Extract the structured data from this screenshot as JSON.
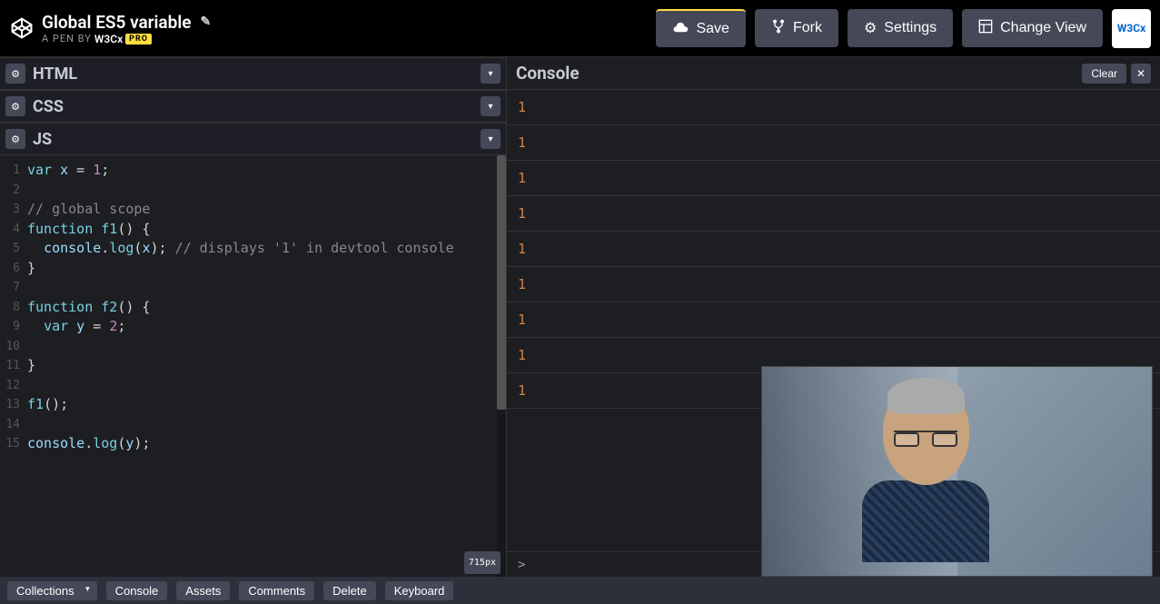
{
  "header": {
    "pen_title": "Global ES5 variable",
    "byline_prefix": "A PEN BY",
    "author": "W3Cx",
    "pro_label": "PRO",
    "buttons": {
      "save": "Save",
      "fork": "Fork",
      "settings": "Settings",
      "change_view": "Change View"
    },
    "avatar_text": "W3Cx"
  },
  "panels": {
    "html": "HTML",
    "css": "CSS",
    "js": "JS"
  },
  "code": {
    "lines": [
      {
        "n": "1"
      },
      {
        "n": "2"
      },
      {
        "n": "3"
      },
      {
        "n": "4"
      },
      {
        "n": "5"
      },
      {
        "n": "6"
      },
      {
        "n": "7"
      },
      {
        "n": "8"
      },
      {
        "n": "9"
      },
      {
        "n": "10"
      },
      {
        "n": "11"
      },
      {
        "n": "12"
      },
      {
        "n": "13"
      },
      {
        "n": "14"
      },
      {
        "n": "15"
      }
    ],
    "l1": {
      "kw": "var",
      "v": "x",
      "eq": " = ",
      "num": "1",
      "sc": ";"
    },
    "l3": {
      "c": "// global scope"
    },
    "l4": {
      "kw": "function",
      "fn": " f1",
      "p": "() {"
    },
    "l5": {
      "ind": "  ",
      "obj": "console",
      "dot": ".",
      "m": "log",
      "op": "(",
      "v": "x",
      "cp": ");",
      "c": " // displays '1' in devtool console"
    },
    "l6": {
      "b": "}"
    },
    "l8": {
      "kw": "function",
      "fn": " f2",
      "p": "() {"
    },
    "l9": {
      "ind": "  ",
      "kw": "var",
      "v": " y",
      "eq": " = ",
      "num": "2",
      "sc": ";"
    },
    "l11": {
      "b": "}"
    },
    "l13": {
      "fn": "f1",
      "p": "();"
    },
    "l15": {
      "obj": "console",
      "dot": ".",
      "m": "log",
      "op": "(",
      "v": "y",
      "cp": ");"
    }
  },
  "size_badge": "715px",
  "console": {
    "title": "Console",
    "clear": "Clear",
    "outputs": [
      "1",
      "1",
      "1",
      "1",
      "1",
      "1",
      "1",
      "1",
      "1"
    ],
    "prompt": ">"
  },
  "footer": {
    "collections": "Collections",
    "console": "Console",
    "assets": "Assets",
    "comments": "Comments",
    "delete": "Delete",
    "keyboard": "Keyboard"
  }
}
